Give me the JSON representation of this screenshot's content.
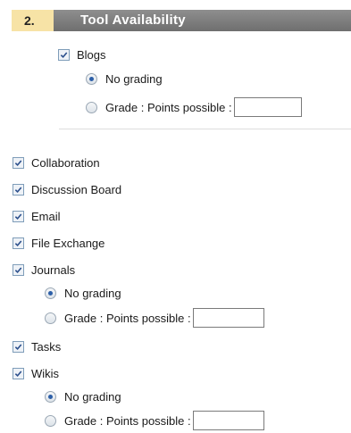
{
  "step": {
    "number": "2.",
    "title": "Tool Availability"
  },
  "blogs": {
    "label": "Blogs",
    "checked": true,
    "options": [
      {
        "label": "No grading",
        "selected": true
      },
      {
        "label": "Grade : Points possible :",
        "selected": false,
        "points_value": ""
      }
    ]
  },
  "tools": {
    "collaboration": {
      "label": "Collaboration",
      "checked": true
    },
    "discussion_board": {
      "label": "Discussion Board",
      "checked": true
    },
    "email": {
      "label": "Email",
      "checked": true
    },
    "file_exchange": {
      "label": "File Exchange",
      "checked": true
    },
    "journals": {
      "label": "Journals",
      "checked": true,
      "options": [
        {
          "label": "No grading",
          "selected": true
        },
        {
          "label": "Grade : Points possible :",
          "selected": false,
          "points_value": ""
        }
      ]
    },
    "tasks": {
      "label": "Tasks",
      "checked": true
    },
    "wikis": {
      "label": "Wikis",
      "checked": true,
      "options": [
        {
          "label": "No grading",
          "selected": true
        },
        {
          "label": "Grade : Points possible :",
          "selected": false,
          "points_value": ""
        }
      ]
    }
  },
  "colors": {
    "checkmark": "#2b4f8c",
    "radio_dot": "#2d5fa8",
    "step_number_bg": "#f7e3a6",
    "step_title_bg": "#7a7a7a"
  }
}
